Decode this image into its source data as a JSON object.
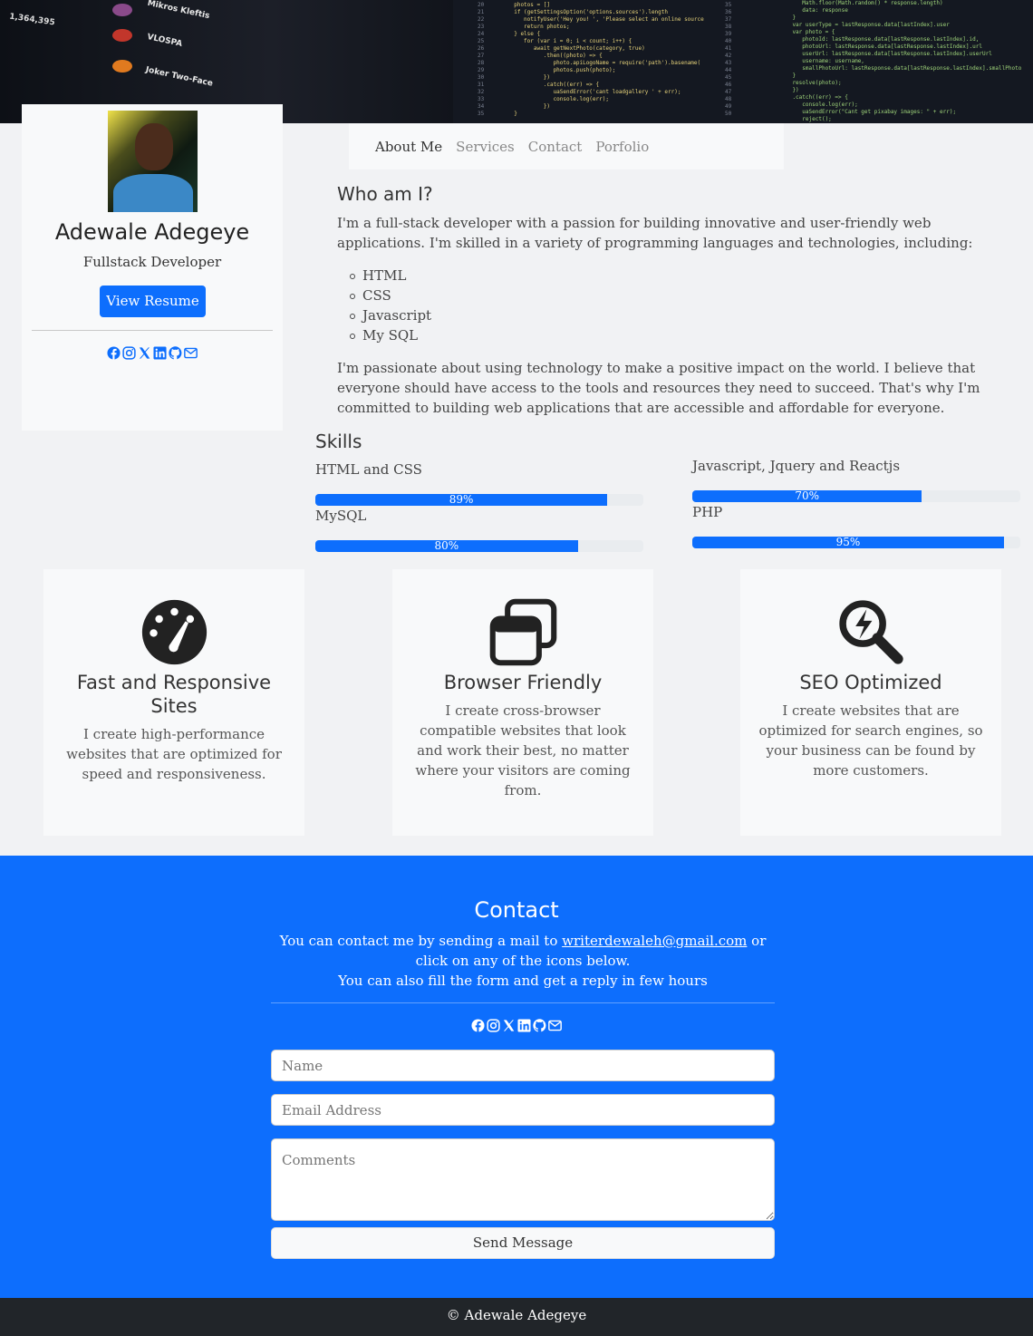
{
  "profile": {
    "name": "Adewale Adegeye",
    "role": "Fullstack Developer",
    "resume_button": "View Resume",
    "social_icons": [
      "facebook-icon",
      "instagram-icon",
      "x-icon",
      "linkedin-icon",
      "github-icon",
      "envelope-icon"
    ]
  },
  "nav": {
    "items": [
      "About Me",
      "Services",
      "Contact",
      "Porfolio"
    ],
    "active": "About Me"
  },
  "about": {
    "heading": "Who am I?",
    "intro": "I'm a full-stack developer with a passion for building innovative and user-friendly web applications. I'm skilled in a variety of programming languages and technologies, including:",
    "languages": [
      "HTML",
      "CSS",
      "Javascript",
      "My SQL"
    ],
    "closing": "I'm passionate about using technology to make a positive impact on the world. I believe that everyone should have access to the tools and resources they need to succeed. That's why I'm committed to building web applications that are accessible and affordable for everyone."
  },
  "skills": {
    "heading": "Skills",
    "items": [
      {
        "label": "HTML and CSS",
        "percent_text": "89%",
        "value": 89
      },
      {
        "label": "Javascript, Jquery and Reactjs",
        "percent_text": "70%",
        "value": 70
      },
      {
        "label": "MySQL",
        "percent_text": "80%",
        "value": 80
      },
      {
        "label": "PHP",
        "percent_text": "95%",
        "value": 95
      }
    ]
  },
  "services": [
    {
      "icon": "speedometer-icon",
      "title": "Fast and Responsive Sites",
      "text": "I create high-performance websites that are optimized for speed and responsiveness."
    },
    {
      "icon": "browser-windows-icon",
      "title": "Browser Friendly",
      "text": "I create cross-browser compatible websites that look and work their best, no matter where your visitors are coming from."
    },
    {
      "icon": "seo-search-icon",
      "title": "SEO Optimized",
      "text": "I create websites that are optimized for search engines, so your business can be found by more customers."
    }
  ],
  "contact": {
    "heading": "Contact",
    "line1_before": "You can contact me by sending a mail to ",
    "email": "writerdewaleh@gmail.com",
    "line1_after": " or click on any of the icons below.",
    "line2": "You can also fill the form and get a reply in few hours",
    "form": {
      "name_placeholder": "Name",
      "email_placeholder": "Email Address",
      "comments_placeholder": "Comments",
      "submit": "Send Message"
    }
  },
  "footer": {
    "text": "© Adewale Adegeye"
  },
  "hero_text": {
    "numbers": [
      "1,364,395"
    ],
    "names": [
      "Mikros Kleftis",
      "VLOSPA",
      "Joker Two-Face"
    ]
  },
  "colors": {
    "primary": "#0d6efd",
    "footer_bg": "#212529",
    "card_bg": "#f8f9fa",
    "page_bg": "#f1f2f4"
  }
}
